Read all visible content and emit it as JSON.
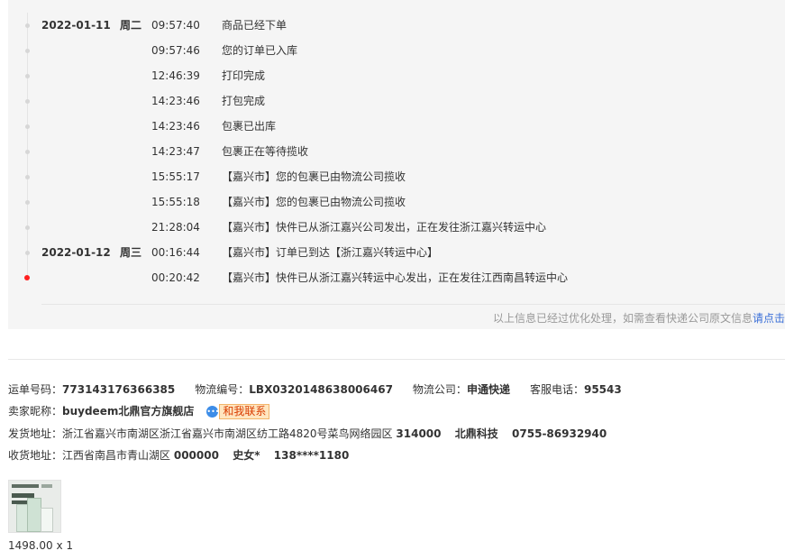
{
  "tracking": {
    "events": [
      {
        "date": "2022-01-11",
        "weekday": "周二",
        "time": "09:57:40",
        "message": "商品已经下单",
        "active": false
      },
      {
        "date": "",
        "weekday": "",
        "time": "09:57:46",
        "message": "您的订单已入库",
        "active": false
      },
      {
        "date": "",
        "weekday": "",
        "time": "12:46:39",
        "message": "打印完成",
        "active": false
      },
      {
        "date": "",
        "weekday": "",
        "time": "14:23:46",
        "message": "打包完成",
        "active": false
      },
      {
        "date": "",
        "weekday": "",
        "time": "14:23:46",
        "message": "包裹已出库",
        "active": false
      },
      {
        "date": "",
        "weekday": "",
        "time": "14:23:47",
        "message": "包裹正在等待揽收",
        "active": false
      },
      {
        "date": "",
        "weekday": "",
        "time": "15:55:17",
        "message": "【嘉兴市】您的包裹已由物流公司揽收",
        "active": false
      },
      {
        "date": "",
        "weekday": "",
        "time": "15:55:18",
        "message": "【嘉兴市】您的包裹已由物流公司揽收",
        "active": false
      },
      {
        "date": "",
        "weekday": "",
        "time": "21:28:04",
        "message": "【嘉兴市】快件已从浙江嘉兴公司发出，正在发往浙江嘉兴转运中心",
        "active": false
      },
      {
        "date": "2022-01-12",
        "weekday": "周三",
        "time": "00:16:44",
        "message": "【嘉兴市】订单已到达【浙江嘉兴转运中心】",
        "active": false
      },
      {
        "date": "",
        "weekday": "",
        "time": "00:20:42",
        "message": "【嘉兴市】快件已从浙江嘉兴转运中心发出，正在发往江西南昌转运中心",
        "active": true
      }
    ],
    "note": "以上信息已经过优化处理，如需查看快递公司原文信息",
    "note_link": "请点击"
  },
  "order": {
    "tracking_no_label": "运单号码：",
    "tracking_no": "773143176366385",
    "logistics_no_label": "物流编号：",
    "logistics_no": "LBX0320148638006467",
    "carrier_label": "物流公司：",
    "carrier": "申通快递",
    "service_phone_label": "客服电话：",
    "service_phone": "95543",
    "seller_label": "卖家昵称：",
    "seller": "buydeem北鼎官方旗舰店",
    "contact_label": "和我联系",
    "ship_from_label": "发货地址：",
    "ship_from_address": "浙江省嘉兴市南湖区浙江省嘉兴市南湖区纺工路4820号菜鸟网络园区",
    "ship_from_zip": "314000",
    "ship_from_name": "北鼎科技",
    "ship_from_phone": "0755-86932940",
    "ship_to_label": "收货地址：",
    "ship_to_address": "江西省南昌市青山湖区",
    "ship_to_zip": "000000",
    "ship_to_name": "史女*",
    "ship_to_phone": "138****1180"
  },
  "product": {
    "price_qty": "1498.00 x 1"
  },
  "icons": {
    "contact": "chat-bubble-icon",
    "timeline_dot": "dot-icon"
  },
  "colors": {
    "active_dot": "#ff1f1f",
    "link": "#3a6fd8",
    "contact_bg": "#ffe6c0"
  }
}
